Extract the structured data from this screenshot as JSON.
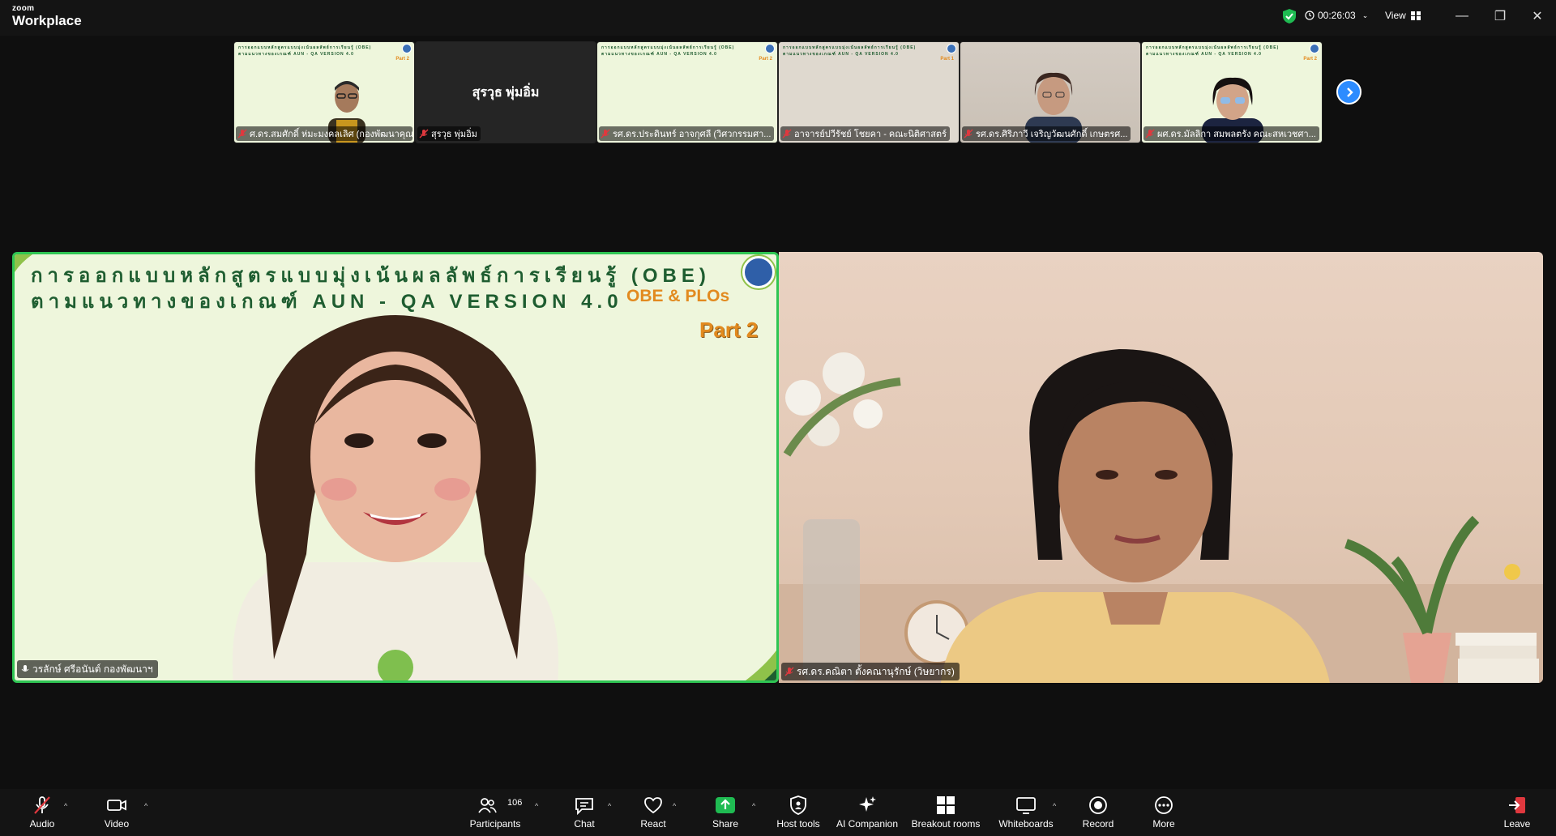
{
  "app": {
    "brand_small": "zoom",
    "brand_large": "Workplace"
  },
  "titlebar": {
    "timer": "00:26:03",
    "view_label": "View",
    "minimize": "—",
    "restore": "❐",
    "close": "✕"
  },
  "thumbnails": [
    {
      "name": "ศ.ดร.สมศักดิ์ ห่มะมงคลเลิศ (กองพัฒนาคุณภ...",
      "muted": true,
      "kind": "slide",
      "slide_line1": "การออกแบบหลักสูตรแบบมุ่งเน้นผลลัพธ์การเรียนรู้ (OBE)",
      "slide_line2": "ตามแนวทางของเกณฑ์ AUN - QA VERSION 4.0",
      "part": "Part 2"
    },
    {
      "name": "สุรวุธ พุ่มอิ่ม",
      "muted": true,
      "kind": "dark",
      "center_name": "สุรวุธ พุ่มอิ่ม"
    },
    {
      "name": "รศ.ดร.ประดินทร์ อาจกุศลี (วิศวกรรมศา...",
      "muted": true,
      "kind": "slide",
      "slide_line1": "การออกแบบหลักสูตรแบบมุ่งเน้นผลลัพธ์การเรียนรู้ (OBE)",
      "slide_line2": "ตามแนวทางของเกณฑ์ AUN - QA VERSION 4.0",
      "part": "Part 2"
    },
    {
      "name": "อาจารย์ปวีรัชย์ โชยคา - คณะนิติศาสตร์",
      "muted": true,
      "kind": "beige",
      "slide_line1": "การออกแบบหลักสูตรแบบมุ่งเน้นผลลัพธ์การเรียนรู้ (OBE)",
      "slide_line2": "ตามแนวทางของเกณฑ์ AUN - QA VERSION 4.0",
      "part": "Part 1"
    },
    {
      "name": "รศ.ดร.ศิริภาวี เจริญวัฒนศักดิ์ เกษตรศ...",
      "muted": true,
      "kind": "room"
    },
    {
      "name": "ผศ.ดร.มัลลิกา สมพลตรัง คณะสหเวชศา...",
      "muted": true,
      "kind": "slide",
      "slide_line1": "การออกแบบหลักสูตรแบบมุ่งเน้นผลลัพธ์การเรียนรู้ (OBE)",
      "slide_line2": "ตามแนวทางของเกณฑ์ AUN - QA VERSION 4.0",
      "part": "Part 2"
    }
  ],
  "main_left": {
    "slide_line1": "การออกแบบหลักสูตรแบบมุ่งเน้นผลลัพธ์การเรียนรู้ (OBE)",
    "slide_line2": "ตามแนวทางของเกณฑ์ AUN - QA VERSION 4.0",
    "slide_obe": "OBE & PLOs",
    "slide_part": "Part 2",
    "name": "วรลักษ์ ศรีอนันต์ กองพัฒนาฯ"
  },
  "main_right": {
    "name": "รศ.ดร.คณิตา ตั้งคณานุรักษ์ (วิษยากร)"
  },
  "toolbar": {
    "audio": "Audio",
    "video": "Video",
    "participants": "Participants",
    "participants_count": "106",
    "chat": "Chat",
    "react": "React",
    "share": "Share",
    "host_tools": "Host tools",
    "ai_companion": "AI Companion",
    "breakout_rooms": "Breakout rooms",
    "whiteboards": "Whiteboards",
    "record": "Record",
    "more": "More",
    "leave": "Leave"
  },
  "colors": {
    "active_speaker_border": "#2fc553",
    "share_green": "#1fbb52",
    "leave_red": "#e0383e",
    "accent_blue": "#2d8cff",
    "slide_green": "#1e5d30",
    "slide_orange": "#e28a1f"
  },
  "icons": [
    "shield-check-icon",
    "clock-icon",
    "chevron-down-icon",
    "grid-view-icon",
    "minimize-icon",
    "restore-icon",
    "close-icon",
    "mic-off-icon",
    "chevron-right-icon",
    "audio-muted-icon",
    "video-camera-icon",
    "participants-icon",
    "chat-icon",
    "react-heart-icon",
    "share-arrow-icon",
    "host-shield-icon",
    "ai-sparkle-icon",
    "breakout-grid-icon",
    "whiteboard-icon",
    "record-icon",
    "more-dots-icon",
    "leave-icon"
  ]
}
